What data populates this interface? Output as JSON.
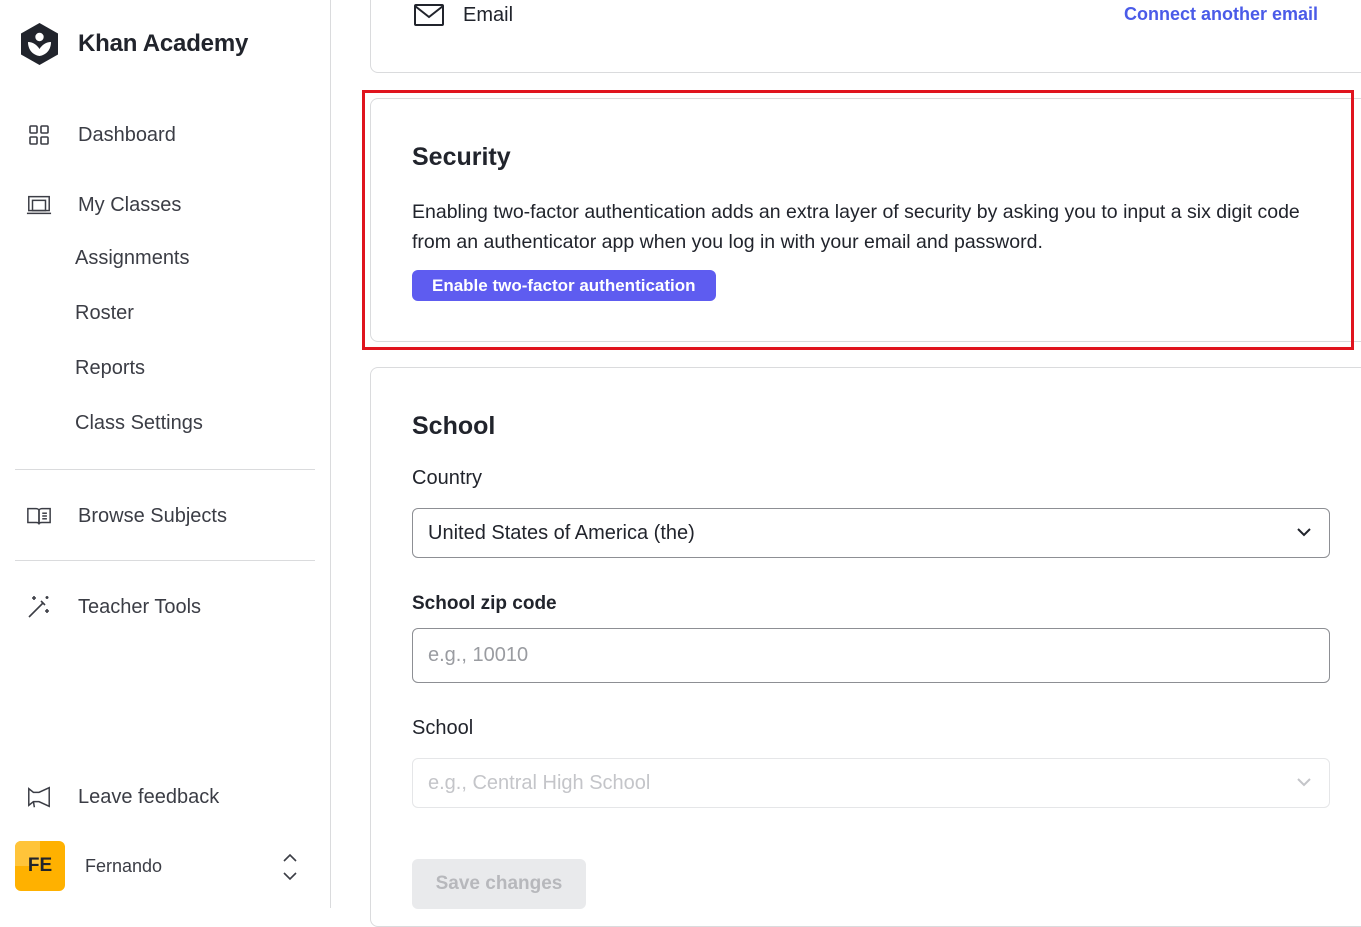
{
  "app": {
    "name": "Khan Academy"
  },
  "sidebar": {
    "items": [
      {
        "label": "Dashboard",
        "icon": "grid-icon"
      },
      {
        "label": "My Classes",
        "icon": "classroom-icon"
      },
      {
        "label": "Browse Subjects",
        "icon": "book-icon"
      },
      {
        "label": "Teacher Tools",
        "icon": "magic-wand-icon"
      }
    ],
    "sub_items": [
      "Assignments",
      "Roster",
      "Reports",
      "Class Settings"
    ],
    "feedback": {
      "label": "Leave feedback",
      "icon": "megaphone-icon"
    },
    "user": {
      "initials": "FE",
      "name": "Fernando"
    }
  },
  "email_section": {
    "label": "Email",
    "icon": "envelope-icon",
    "connect_link": "Connect another email"
  },
  "security": {
    "title": "Security",
    "description": "Enabling two-factor authentication adds an extra layer of security by asking you to input a six digit code from an authenticator app when you log in with your email and password.",
    "button": "Enable two-factor authentication"
  },
  "school": {
    "title": "School",
    "country_label": "Country",
    "country_value": "United States of America (the)",
    "zip_label": "School zip code",
    "zip_placeholder": "e.g., 10010",
    "school_label": "School",
    "school_placeholder": "e.g., Central High School",
    "save_button": "Save changes"
  },
  "colors": {
    "accent": "#5e5cf0",
    "link": "#4a5be8",
    "highlight": "#e0141e",
    "avatar": "#ffb100"
  }
}
